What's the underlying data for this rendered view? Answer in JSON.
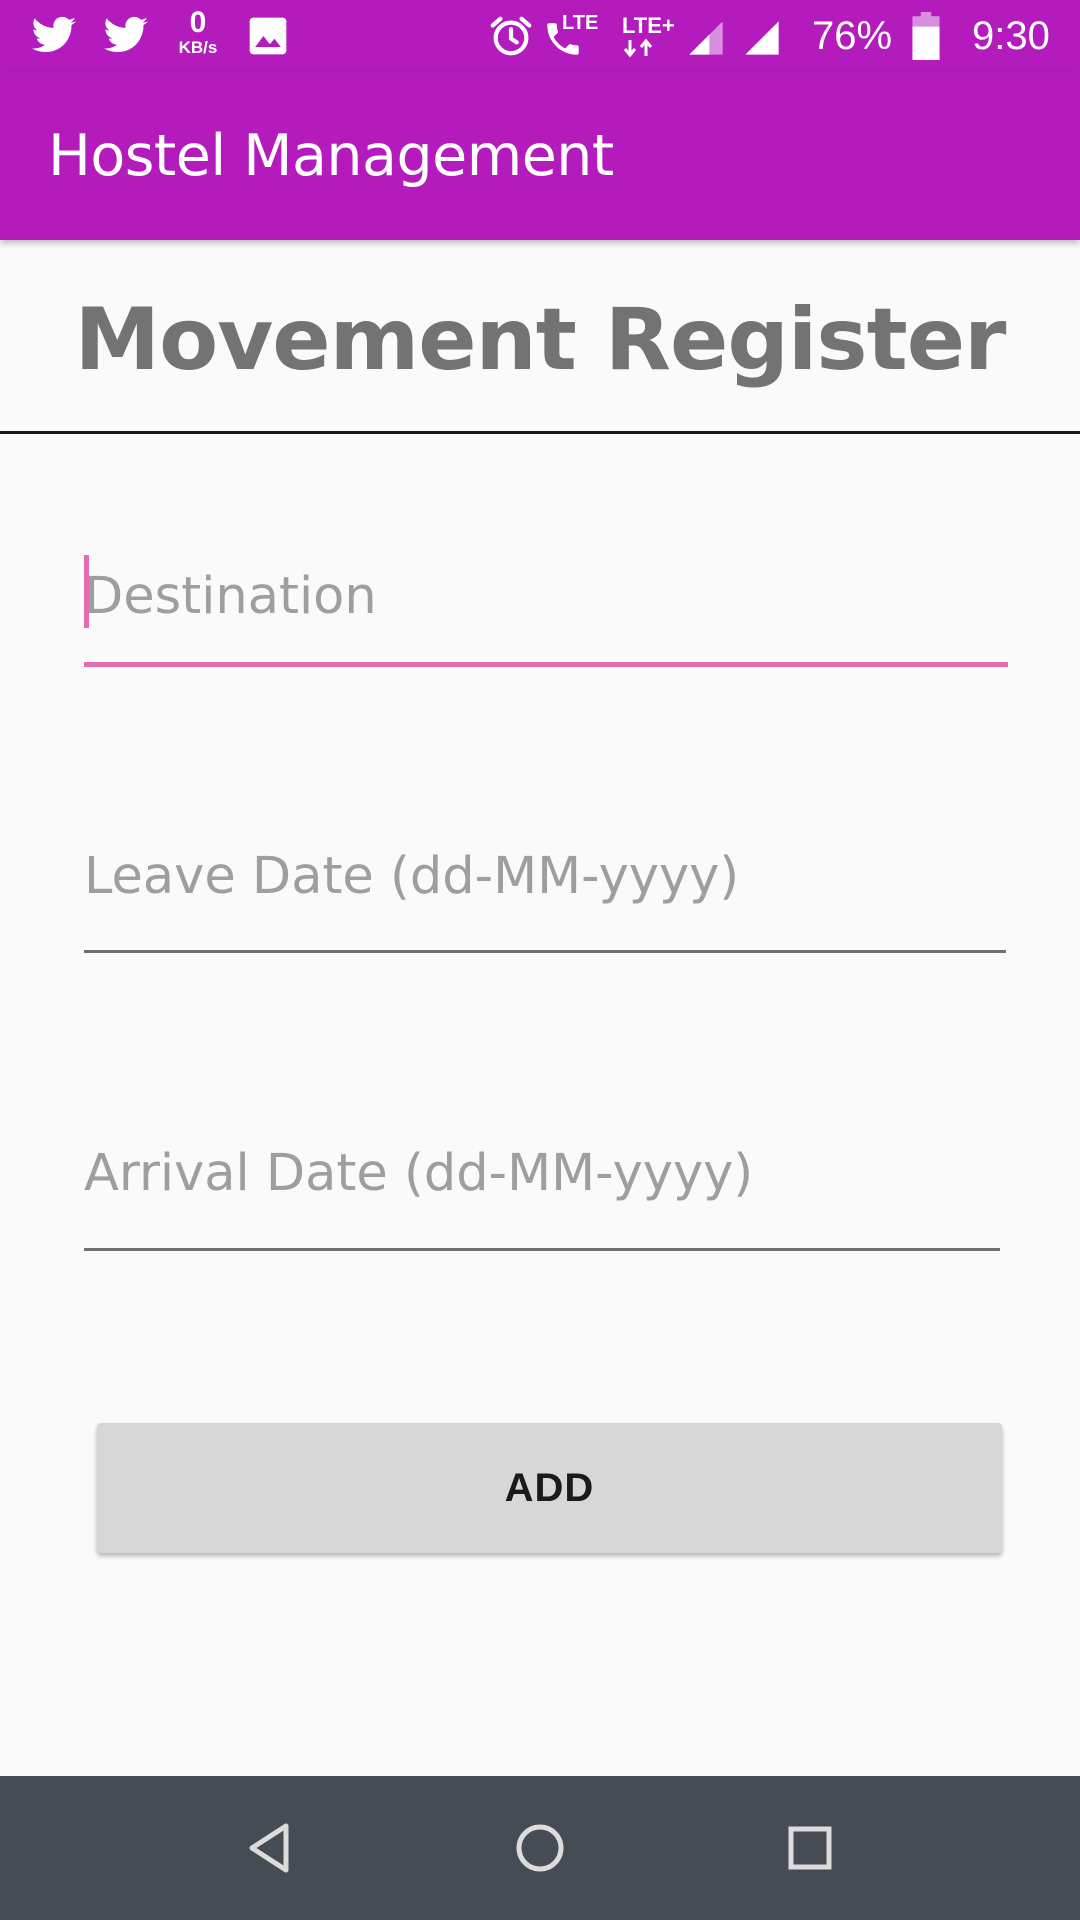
{
  "status_bar": {
    "notification_icons": [
      "twitter-icon",
      "twitter-icon",
      "data-speed-indicator",
      "image-icon"
    ],
    "data_speed_value": "0",
    "data_speed_unit": "KB/s",
    "system_icons": [
      "alarm-icon",
      "volte-call-icon",
      "lte-plus-icon",
      "signal-icon",
      "signal-icon",
      "battery-icon"
    ],
    "volte_label": "LTE",
    "network_label": "LTE+",
    "battery_percent": "76%",
    "battery_level": 0.76,
    "time": "9:30"
  },
  "app_bar": {
    "title": "Hostel Management",
    "color": "#b31bbd"
  },
  "page": {
    "heading": "Movement Register"
  },
  "form": {
    "destination": {
      "value": "",
      "placeholder": "Destination",
      "focused": true
    },
    "leave_date": {
      "value": "",
      "placeholder": "Leave Date (dd-MM-yyyy)"
    },
    "arrival_date": {
      "value": "",
      "placeholder": "Arrival Date (dd-MM-yyyy)"
    },
    "add_button_label": "ADD"
  },
  "nav_bar": {
    "buttons": [
      "back-icon",
      "home-icon",
      "recents-icon"
    ]
  },
  "colors": {
    "primary": "#b31bbd",
    "accent": "#e66bb3",
    "heading_text": "#737373",
    "placeholder_text": "#9e9e9e",
    "button_background": "#d7d7d7",
    "nav_bar_background": "#454c53"
  }
}
